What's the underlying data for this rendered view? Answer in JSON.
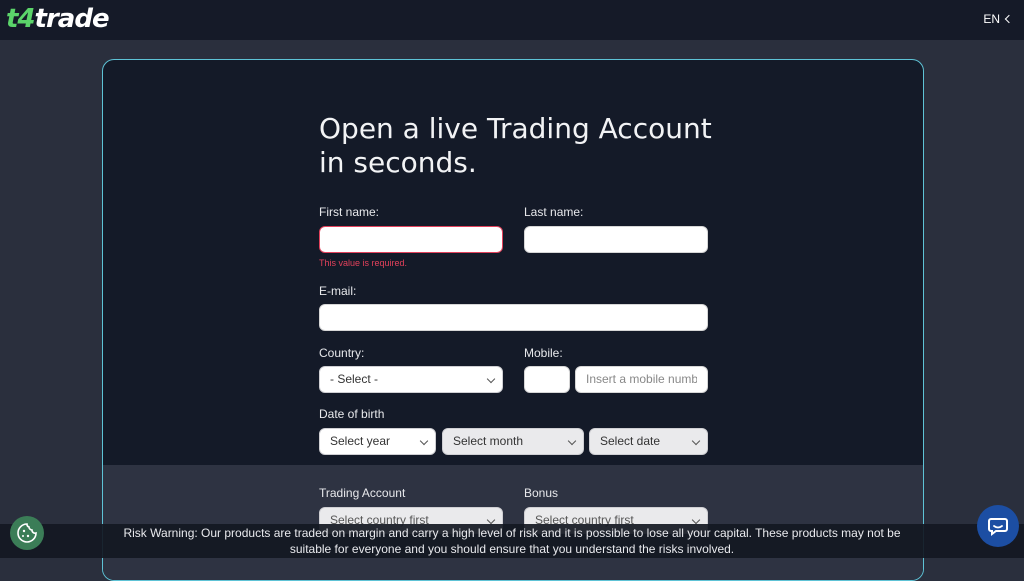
{
  "header": {
    "logo_prefix": "t4",
    "logo_suffix": "trade",
    "language": "EN"
  },
  "form": {
    "title": "Open a live Trading Account in seconds.",
    "first_name_label": "First name:",
    "first_name_value": "",
    "first_name_error": "This value is required.",
    "last_name_label": "Last name:",
    "last_name_value": "",
    "email_label": "E-mail:",
    "email_value": "",
    "country_label": "Country:",
    "country_selected": "- Select -",
    "mobile_label": "Mobile:",
    "mobile_code_value": "",
    "mobile_placeholder": "Insert a mobile number",
    "dob_label": "Date of birth",
    "dob_year": "Select year",
    "dob_month": "Select month",
    "dob_date": "Select date",
    "trading_account_label": "Trading Account",
    "trading_account_selected": "Select country first",
    "bonus_label": "Bonus",
    "bonus_selected": "Select country first"
  },
  "risk_warning": "Risk Warning: Our products are traded on margin and carry a high level of risk and it is possible to lose all your capital. These products may not be suitable for everyone and you should ensure that you understand the risks involved.",
  "colors": {
    "brand_green": "#5bd46a",
    "card_border": "#5ec3d6",
    "error_red": "#e2415b",
    "chat_blue": "#1c4ea3"
  },
  "icons": [
    "chevron-left-icon",
    "chevron-down-icon",
    "cookie-icon",
    "chat-icon"
  ]
}
